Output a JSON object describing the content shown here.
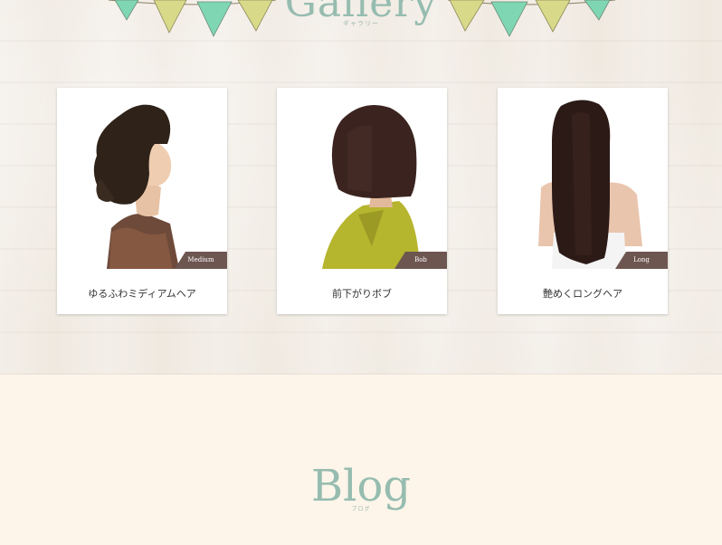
{
  "gallery": {
    "title": "Gallery",
    "subtitle": "ギャラリー",
    "items": [
      {
        "name": "ゆるふわミディアムヘア",
        "tag": "Medium"
      },
      {
        "name": "前下がりボブ",
        "tag": "Bob"
      },
      {
        "name": "艶めくロングヘア",
        "tag": "Long"
      }
    ]
  },
  "blog": {
    "title": "Blog",
    "subtitle": "ブログ"
  },
  "colors": {
    "accent_teal": "#96bcb0",
    "tag_brown": "#6e5650",
    "flag_yellow": "#d9d98a",
    "flag_green": "#7fd6b3"
  }
}
